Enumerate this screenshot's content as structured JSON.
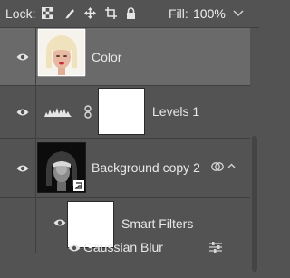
{
  "toolbar": {
    "lock_label": "Lock:",
    "fill_label": "Fill:",
    "fill_value": "100%",
    "lock_icons": [
      "lock-transparent-pixels-icon",
      "lock-image-pixels-icon",
      "lock-position-icon",
      "lock-artboard-icon",
      "lock-all-icon"
    ]
  },
  "layers": [
    {
      "name": "Color",
      "visible": true,
      "selected": true,
      "thumbnail": "portrait-thumbnail"
    },
    {
      "name": "Levels 1",
      "visible": true,
      "selected": false,
      "thumbnail": "levels-adjustment",
      "mask": "white"
    },
    {
      "name": "Background copy 2",
      "visible": true,
      "selected": false,
      "thumbnail": "smart-object-portrait"
    },
    {
      "name": "Smart Filters",
      "visible": true,
      "selected": false,
      "thumbnail": "white-mask"
    },
    {
      "name": "Gaussian Blur",
      "visible": true,
      "selected": false
    }
  ],
  "colors": {
    "panel_bg": "#535353",
    "selected_row": "#6a6a6a",
    "text": "#e8e8e8",
    "divider": "#3f3f3f"
  }
}
